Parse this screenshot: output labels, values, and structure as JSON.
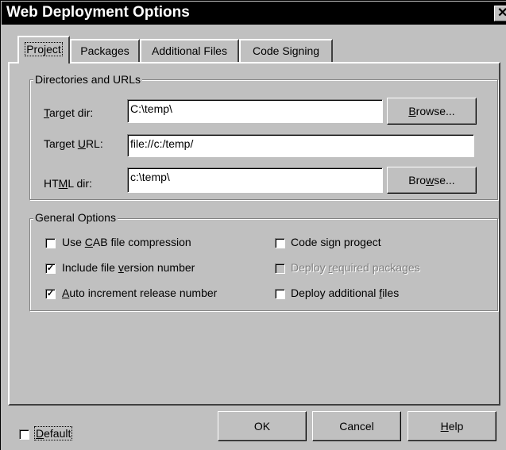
{
  "window": {
    "title": "Web Deployment Options",
    "close_glyph": "✕"
  },
  "tabs": [
    {
      "label": "Project",
      "active": true
    },
    {
      "label": "Packages",
      "active": false
    },
    {
      "label": "Additional Files",
      "active": false
    },
    {
      "label": "Code Signing",
      "active": false
    }
  ],
  "directories": {
    "legend": "Directories and URLs",
    "target_dir_label": "Target dir:",
    "target_dir_value": "C:\\temp\\",
    "target_url_label": "Target URL:",
    "target_url_value": "file://c:/temp/",
    "html_dir_label": "HTML dir:",
    "html_dir_value": "c:\\temp\\",
    "browse_label": "Browse..."
  },
  "general": {
    "legend": "General Options",
    "options": [
      {
        "label": "Use CAB file compression",
        "checked": false,
        "enabled": true
      },
      {
        "label": "Include file version number",
        "checked": true,
        "enabled": true
      },
      {
        "label": "Auto increment release number",
        "checked": true,
        "enabled": true
      },
      {
        "label": "Code sign progect",
        "checked": false,
        "enabled": true
      },
      {
        "label": "Deploy required packages",
        "checked": false,
        "enabled": false
      },
      {
        "label": "Deploy additional files",
        "checked": false,
        "enabled": true
      }
    ]
  },
  "footer": {
    "default_label": "Default",
    "default_checked": false,
    "ok_label": "OK",
    "cancel_label": "Cancel",
    "help_label": "Help"
  }
}
